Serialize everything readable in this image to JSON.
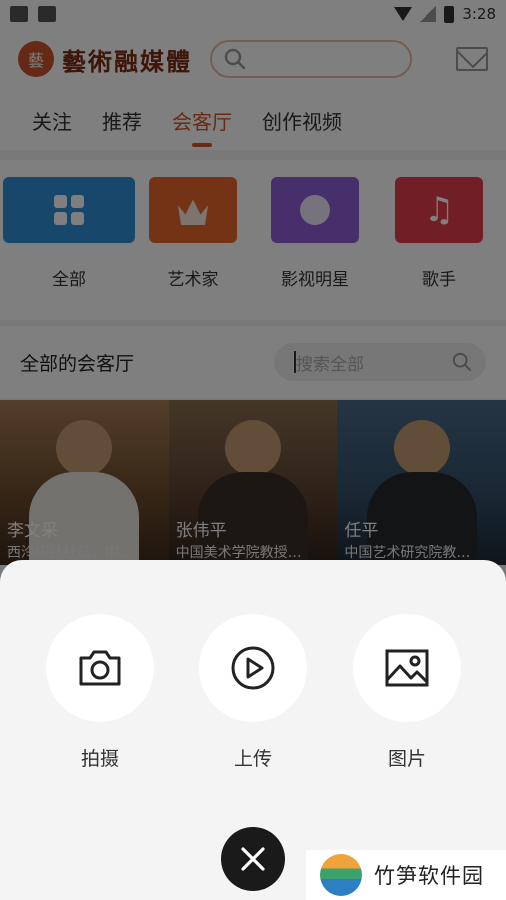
{
  "status_bar": {
    "time": "3:28"
  },
  "header": {
    "brand_name": "藝術融媒體",
    "seal_char": "藝"
  },
  "tabs": [
    {
      "label": "关注",
      "active": false
    },
    {
      "label": "推荐",
      "active": false
    },
    {
      "label": "会客厅",
      "active": true
    },
    {
      "label": "创作视频",
      "active": false
    }
  ],
  "categories": [
    {
      "label": "全部",
      "color": "#2f8fd6",
      "icon": "grid-icon"
    },
    {
      "label": "艺术家",
      "color": "#e9662b",
      "icon": "crown-icon"
    },
    {
      "label": "影视明星",
      "color": "#8c5fd6",
      "icon": "film-reel-icon"
    },
    {
      "label": "歌手",
      "color": "#e33d4d",
      "icon": "music-note-icon"
    }
  ],
  "section": {
    "title": "全部的会客厅",
    "search_placeholder": "搜索全部"
  },
  "cards": [
    {
      "name": "李文采",
      "desc": "西泠印社社员，中…"
    },
    {
      "name": "张伟平",
      "desc": "中国美术学院教授…"
    },
    {
      "name": "任平",
      "desc": "中国艺术研究院教…"
    }
  ],
  "sheet": {
    "actions": [
      {
        "label": "拍摄",
        "icon": "camera-icon"
      },
      {
        "label": "上传",
        "icon": "play-circle-icon"
      },
      {
        "label": "图片",
        "icon": "image-icon"
      }
    ]
  },
  "watermark": {
    "text": "竹笋软件园"
  },
  "colors": {
    "accent": "#d4552a",
    "close_button": "#1a1a1a",
    "sheet_bg": "#f4f4f4"
  }
}
